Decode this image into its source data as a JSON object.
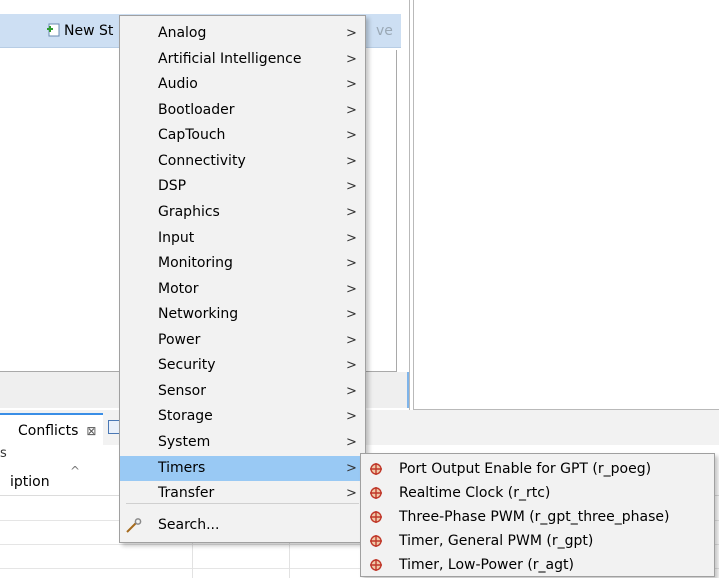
{
  "toolbar": {
    "new_stack_label": "New St",
    "remove_label": "ve"
  },
  "bottom_panel": {
    "tab_label": "Conflicts",
    "tab_close": "⊠",
    "header_partial": "s",
    "column_description": "iption",
    "sort_caret": "^"
  },
  "context_menu": {
    "items": [
      {
        "label": "Analog",
        "arrow": ">"
      },
      {
        "label": "Artificial Intelligence",
        "arrow": ">"
      },
      {
        "label": "Audio",
        "arrow": ">"
      },
      {
        "label": "Bootloader",
        "arrow": ">"
      },
      {
        "label": "CapTouch",
        "arrow": ">"
      },
      {
        "label": "Connectivity",
        "arrow": ">"
      },
      {
        "label": "DSP",
        "arrow": ">"
      },
      {
        "label": "Graphics",
        "arrow": ">"
      },
      {
        "label": "Input",
        "arrow": ">"
      },
      {
        "label": "Monitoring",
        "arrow": ">"
      },
      {
        "label": "Motor",
        "arrow": ">"
      },
      {
        "label": "Networking",
        "arrow": ">"
      },
      {
        "label": "Power",
        "arrow": ">"
      },
      {
        "label": "Security",
        "arrow": ">"
      },
      {
        "label": "Sensor",
        "arrow": ">"
      },
      {
        "label": "Storage",
        "arrow": ">"
      },
      {
        "label": "System",
        "arrow": ">"
      },
      {
        "label": "Timers",
        "arrow": ">"
      },
      {
        "label": "Transfer",
        "arrow": ">"
      }
    ],
    "search_label": "Search...",
    "selected_item": "Timers"
  },
  "timers_submenu": {
    "items": [
      {
        "label": "Port Output Enable for GPT (r_poeg)",
        "icon": "component-icon"
      },
      {
        "label": "Realtime Clock (r_rtc)",
        "icon": "component-icon"
      },
      {
        "label": "Three-Phase PWM (r_gpt_three_phase)",
        "icon": "component-icon"
      },
      {
        "label": "Timer, General PWM (r_gpt)",
        "icon": "component-icon"
      },
      {
        "label": "Timer, Low-Power (r_agt)",
        "icon": "component-icon"
      }
    ]
  },
  "colors": {
    "menu_background": "#f2f2f2",
    "selection": "#99c9f4",
    "toolbar": "#cddff3",
    "icon_accent": "#c0392b"
  }
}
